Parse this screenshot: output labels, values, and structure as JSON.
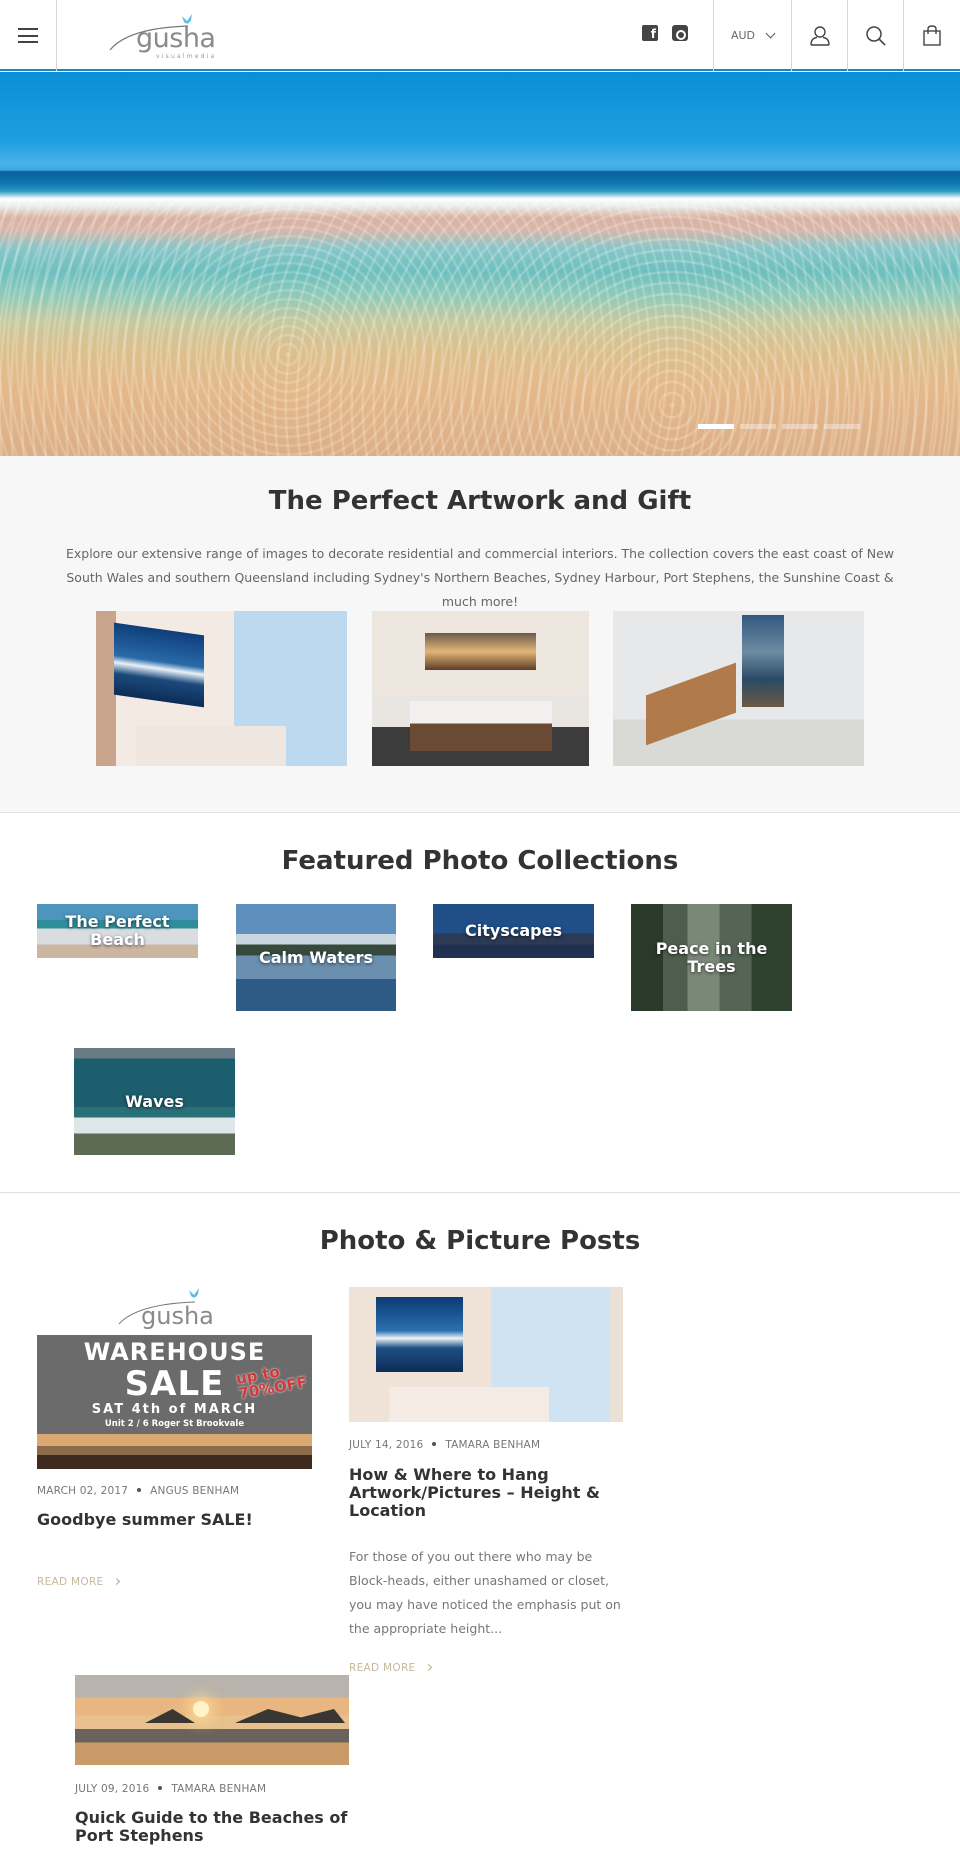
{
  "header": {
    "menu_icon": "hamburger-icon",
    "logo": {
      "wordmark": "gusha",
      "tagline": "visualmedia",
      "bird_color": "#5bbde3"
    },
    "social": [
      {
        "name": "facebook",
        "icon": "facebook-icon",
        "glyph": "f"
      },
      {
        "name": "instagram",
        "icon": "instagram-icon",
        "glyph": ""
      }
    ],
    "currency": {
      "selected": "AUD",
      "icon": "chevron-down-icon"
    },
    "account_icon": "user-icon",
    "search_icon": "search-icon",
    "cart_icon": "shopping-bag-icon",
    "accent_color": "#1a86c7"
  },
  "hero": {
    "slides": 4,
    "active_slide": 1
  },
  "intro": {
    "title": "The Perfect Artwork and Gift",
    "description": "Explore our extensive range of images to decorate residential and commercial interiors. The collection covers the east coast of New South Wales and southern Queensland including Sydney's Northern Beaches, Sydney Harbour, Port Stephens, the Sunshine Coast & much more!",
    "rooms": [
      "Living room with ocean artwork",
      "Bedroom with boardwalk sunset artwork",
      "Lounge chair with boat artwork"
    ]
  },
  "collections": {
    "title": "Featured Photo Collections",
    "items": [
      {
        "label": "The Perfect Beach"
      },
      {
        "label": "Calm Waters"
      },
      {
        "label": "Cityscapes"
      },
      {
        "label": "Peace in the Trees"
      },
      {
        "label": "Waves"
      }
    ]
  },
  "posts": {
    "title": "Photo & Picture Posts",
    "items": [
      {
        "date": "MARCH 02, 2017",
        "author": "ANGUS BENHAM",
        "title": "Goodbye summer SALE!",
        "excerpt": "",
        "read_more": "READ MORE",
        "banner": {
          "line1": "WAREHOUSE",
          "line2": "SALE",
          "badge": "up to 70% OFF",
          "badge_top": "up to",
          "badge_bottom": "70%OFF",
          "date": "SAT 4th of MARCH",
          "address": "Unit 2 / 6 Roger St Brookvale"
        }
      },
      {
        "date": "JULY 14, 2016",
        "author": "TAMARA BENHAM",
        "title": "How & Where to Hang Artwork/Pictures – Height & Location",
        "excerpt": "For those of you out there who may be Block-heads, either unashamed or closet, you may have noticed the emphasis put on the appropriate height...",
        "read_more": "READ MORE"
      },
      {
        "date": "JULY 09, 2016",
        "author": "TAMARA BENHAM",
        "title": "Quick Guide to the Beaches of Port Stephens",
        "excerpt": ""
      }
    ]
  }
}
